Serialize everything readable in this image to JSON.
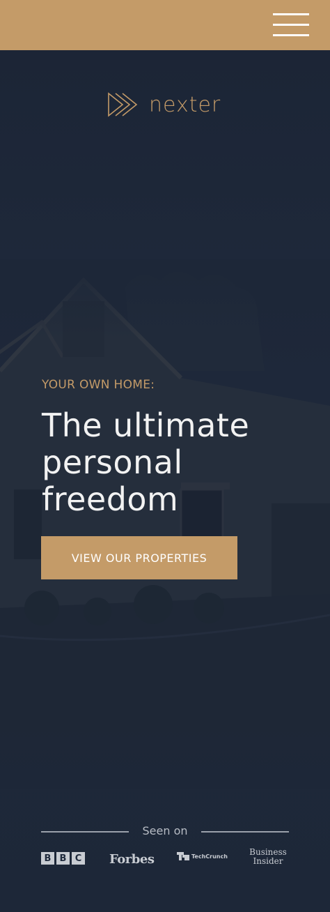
{
  "brand": {
    "name": "nexter",
    "accent": "#c49b68",
    "navy": "#1d2739"
  },
  "header": {
    "menu_icon": "hamburger-menu-icon"
  },
  "hero": {
    "eyebrow": "YOUR OWN HOME:",
    "headline": "The ultimate personal freedom",
    "cta_label": "VIEW OUR PROPERTIES"
  },
  "press": {
    "label": "Seen on",
    "logos": {
      "bbc": [
        "B",
        "B",
        "C"
      ],
      "forbes": "Forbes",
      "techcrunch": "TechCrunch",
      "insider_line1": "Business",
      "insider_line2": "Insider"
    }
  }
}
